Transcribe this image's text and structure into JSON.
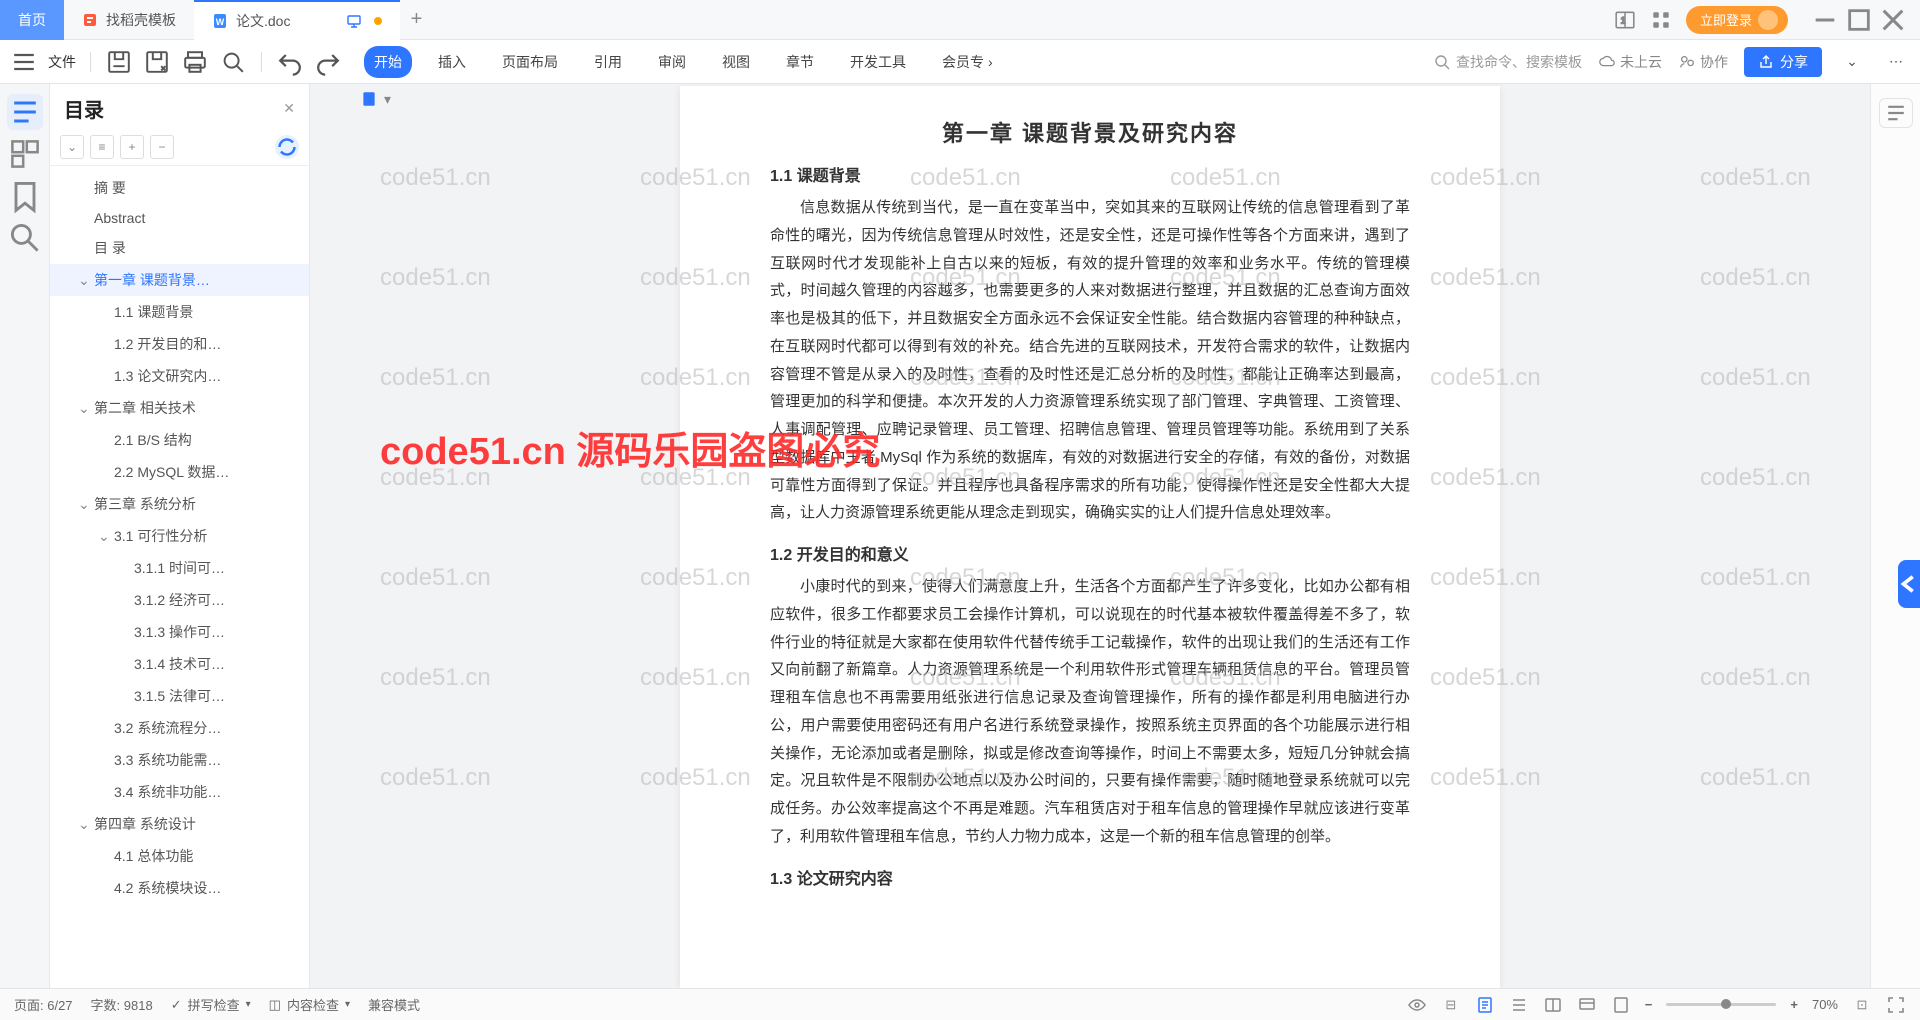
{
  "tabs": {
    "home": "首页",
    "t1": "找稻壳模板",
    "t2": "论文.doc"
  },
  "login": "立即登录",
  "fileMenu": "文件",
  "ribbon": [
    "开始",
    "插入",
    "页面布局",
    "引用",
    "审阅",
    "视图",
    "章节",
    "开发工具"
  ],
  "member": "会员专",
  "searchPlaceholder": "查找命令、搜索模板",
  "cloud": "未上云",
  "collab": "协作",
  "share": "分享",
  "outlineTitle": "目录",
  "toc": [
    {
      "d": 1,
      "t": "摘    要"
    },
    {
      "d": 1,
      "t": "Abstract"
    },
    {
      "d": 1,
      "t": "目    录"
    },
    {
      "d": 1,
      "t": "第一章   课题背景…",
      "c": true,
      "sel": true
    },
    {
      "d": 2,
      "t": "1.1  课题背景"
    },
    {
      "d": 2,
      "t": "1.2  开发目的和…"
    },
    {
      "d": 2,
      "t": "1.3  论文研究内…"
    },
    {
      "d": 1,
      "t": "第二章   相关技术",
      "c": true
    },
    {
      "d": 2,
      "t": "2.1 B/S 结构"
    },
    {
      "d": 2,
      "t": "2.2 MySQL 数据…"
    },
    {
      "d": 1,
      "t": "第三章  系统分析",
      "c": true
    },
    {
      "d": 2,
      "t": "3.1 可行性分析",
      "c": true
    },
    {
      "d": 3,
      "t": "3.1.1  时间可…"
    },
    {
      "d": 3,
      "t": "3.1.2  经济可…"
    },
    {
      "d": 3,
      "t": "3.1.3  操作可…"
    },
    {
      "d": 3,
      "t": "3.1.4  技术可…"
    },
    {
      "d": 3,
      "t": "3.1.5  法律可…"
    },
    {
      "d": 2,
      "t": "3.2  系统流程分…"
    },
    {
      "d": 2,
      "t": "3.3  系统功能需…"
    },
    {
      "d": 2,
      "t": "3.4  系统非功能…"
    },
    {
      "d": 1,
      "t": "第四章   系统设计",
      "c": true
    },
    {
      "d": 2,
      "t": "4.1  总体功能"
    },
    {
      "d": 2,
      "t": "4.2  系统模块设…"
    }
  ],
  "doc": {
    "chTitle": "第一章    课题背景及研究内容",
    "h11": "1.1  课题背景",
    "p1": "信息数据从传统到当代，是一直在变革当中，突如其来的互联网让传统的信息管理看到了革命性的曙光，因为传统信息管理从时效性，还是安全性，还是可操作性等各个方面来讲，遇到了互联网时代才发现能补上自古以来的短板，有效的提升管理的效率和业务水平。传统的管理模式，时间越久管理的内容越多，也需要更多的人来对数据进行整理，并且数据的汇总查询方面效率也是极其的低下，并且数据安全方面永远不会保证安全性能。结合数据内容管理的种种缺点，在互联网时代都可以得到有效的补充。结合先进的互联网技术，开发符合需求的软件，让数据内容管理不管是从录入的及时性，查看的及时性还是汇总分析的及时性，都能让正确率达到最高，管理更加的科学和便捷。本次开发的人力资源管理系统实现了部门管理、字典管理、工资管理、人事调配管理、应聘记录管理、员工管理、招聘信息管理、管理员管理等功能。系统用到了关系型数据库中王者 MySql 作为系统的数据库，有效的对数据进行安全的存储，有效的备份，对数据可靠性方面得到了保证。并且程序也具备程序需求的所有功能，使得操作性还是安全性都大大提高，让人力资源管理系统更能从理念走到现实，确确实实的让人们提升信息处理效率。",
    "h12": "1.2  开发目的和意义",
    "p2": "小康时代的到来，使得人们满意度上升，生活各个方面都产生了许多变化，比如办公都有相应软件，很多工作都要求员工会操作计算机，可以说现在的时代基本被软件覆盖得差不多了，软件行业的特征就是大家都在使用软件代替传统手工记载操作，软件的出现让我们的生活还有工作又向前翻了新篇章。人力资源管理系统是一个利用软件形式管理车辆租赁信息的平台。管理员管理租车信息也不再需要用纸张进行信息记录及查询管理操作，所有的操作都是利用电脑进行办公，用户需要使用密码还有用户名进行系统登录操作，按照系统主页界面的各个功能展示进行相关操作，无论添加或者是删除，拟或是修改查询等操作，时间上不需要太多，短短几分钟就会搞定。况且软件是不限制办公地点以及办公时间的，只要有操作需要，随时随地登录系统就可以完成任务。办公效率提高这个不再是难题。汽车租赁店对于租车信息的管理操作早就应该进行变革了，利用软件管理租车信息，节约人力物力成本，这是一个新的租车信息管理的创举。",
    "h13": "1.3  论文研究内容"
  },
  "watermark": "code51.cn",
  "watermark_red": "code51.cn 源码乐园盗图必究",
  "status": {
    "page": "页面: 6/27",
    "words": "字数: 9818",
    "spell": "拼写检查",
    "content": "内容检查",
    "compat": "兼容模式",
    "zoom": "70%"
  }
}
